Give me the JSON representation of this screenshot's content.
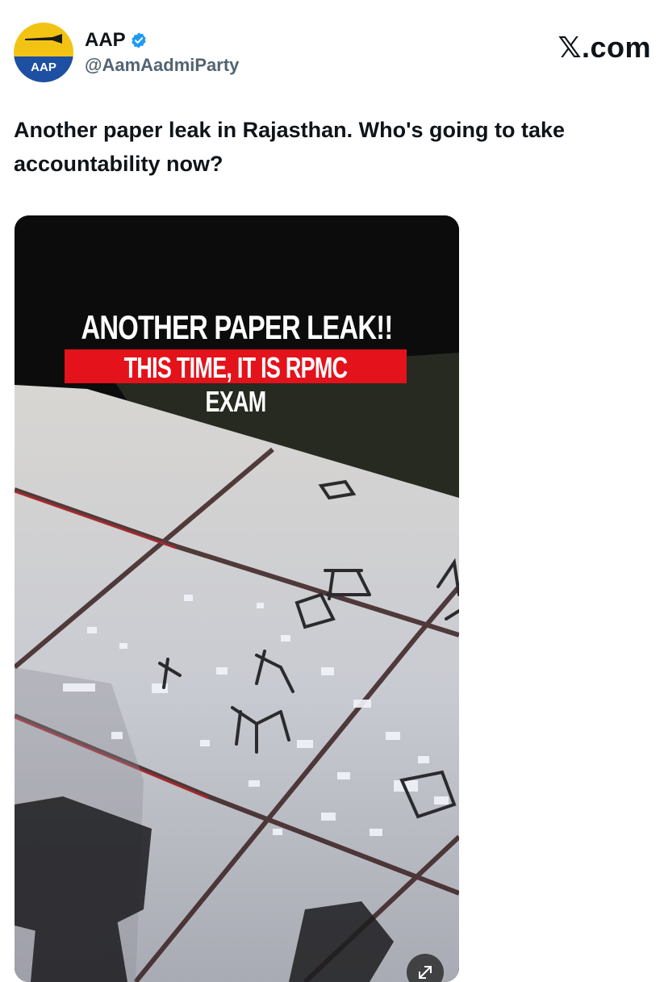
{
  "account": {
    "display_name": "AAP",
    "handle": "@AamAadmiParty",
    "avatar_text": "AAP",
    "verified": true
  },
  "brand": {
    "mark": "𝕏",
    "text": ".com"
  },
  "tweet": {
    "text": "Another paper leak in Rajasthan. Who's going to take accountability now?"
  },
  "media": {
    "caption_line1": "ANOTHER PAPER LEAK!!",
    "caption_line2": "THIS TIME, IT IS RPMC EXAM"
  },
  "colors": {
    "verified_badge": "#1d9bf0",
    "avatar_yellow": "#f3c314",
    "avatar_blue": "#1d4fa3",
    "caption_red": "#e3121b",
    "handle_gray": "#536471"
  }
}
